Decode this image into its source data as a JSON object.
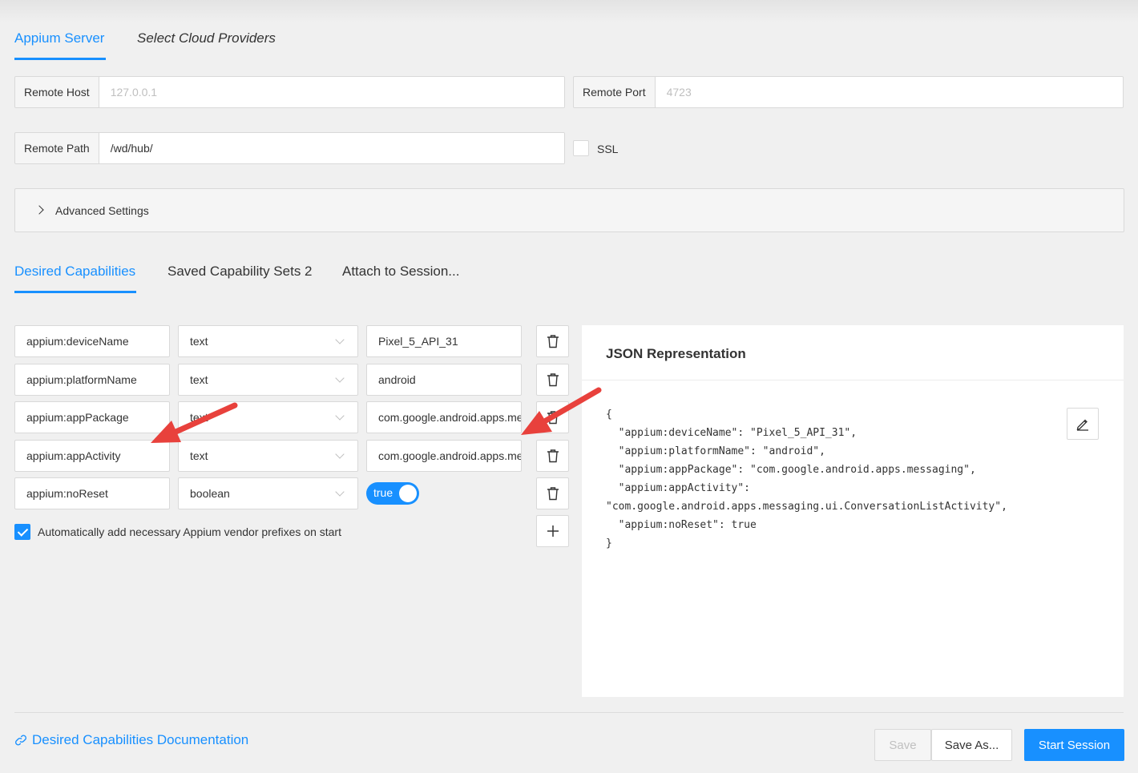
{
  "server_tabs": [
    {
      "label": "Appium Server",
      "active": true
    },
    {
      "label": "Select Cloud Providers",
      "active": false
    }
  ],
  "remote_host": {
    "label": "Remote Host",
    "placeholder": "127.0.0.1",
    "value": ""
  },
  "remote_port": {
    "label": "Remote Port",
    "placeholder": "4723",
    "value": ""
  },
  "remote_path": {
    "label": "Remote Path",
    "value": "/wd/hub/"
  },
  "ssl": {
    "label": "SSL",
    "checked": false
  },
  "advanced_settings": {
    "label": "Advanced Settings"
  },
  "capability_tabs": [
    {
      "label": "Desired Capabilities",
      "active": true
    },
    {
      "label": "Saved Capability Sets 2",
      "active": false
    },
    {
      "label": "Attach to Session...",
      "active": false
    }
  ],
  "capabilities": [
    {
      "name": "appium:deviceName",
      "type": "text",
      "value": "Pixel_5_API_31"
    },
    {
      "name": "appium:platformName",
      "type": "text",
      "value": "android"
    },
    {
      "name": "appium:appPackage",
      "type": "text",
      "value": "com.google.android.apps.messaging"
    },
    {
      "name": "appium:appActivity",
      "type": "text",
      "value": "com.google.android.apps.messaging.ui.ConversationListActivity"
    },
    {
      "name": "appium:noReset",
      "type": "boolean",
      "value": "true"
    }
  ],
  "auto_prefix": {
    "label": "Automatically add necessary Appium vendor prefixes on start",
    "checked": true
  },
  "json_panel": {
    "title": "JSON Representation",
    "code": "{\n  \"appium:deviceName\": \"Pixel_5_API_31\",\n  \"appium:platformName\": \"android\",\n  \"appium:appPackage\": \"com.google.android.apps.messaging\",\n  \"appium:appActivity\":\n\"com.google.android.apps.messaging.ui.ConversationListActivity\",\n  \"appium:noReset\": true\n}"
  },
  "footer": {
    "doc_link": "Desired Capabilities Documentation",
    "save": "Save",
    "save_as": "Save As...",
    "start_session": "Start Session"
  },
  "colors": {
    "accent": "#1890ff",
    "annotation_arrow": "#e8413c"
  },
  "icons": {
    "delete": "trash-icon",
    "add": "plus-icon",
    "edit": "pencil-icon",
    "link": "link-icon",
    "expand": "chevron-right-icon"
  }
}
